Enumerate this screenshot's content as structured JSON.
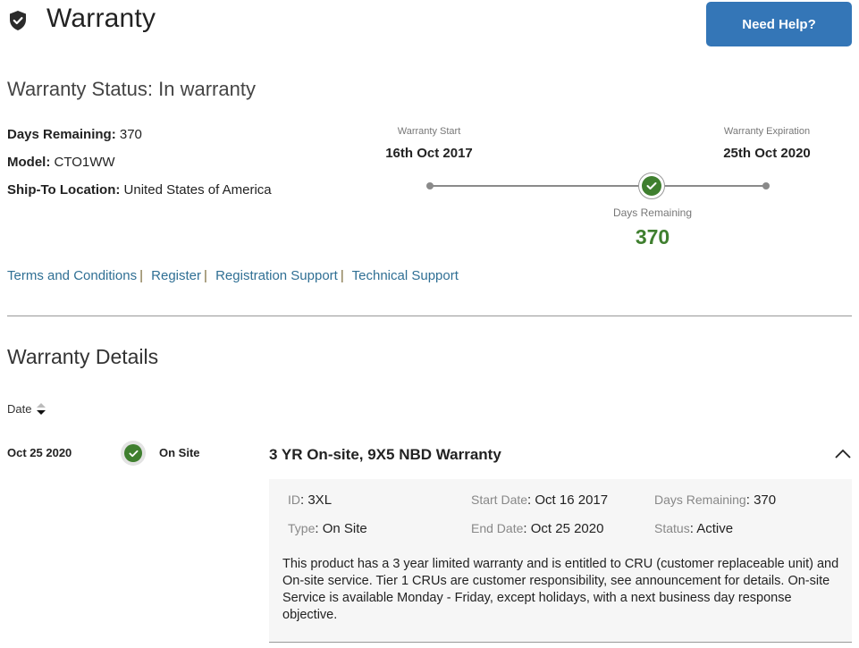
{
  "header": {
    "title": "Warranty",
    "icon": "shield-check-icon",
    "help_button": "Need Help?"
  },
  "status": {
    "title": "Warranty Status: In warranty",
    "days_remaining_label": "Days Remaining:",
    "days_remaining_value": "370",
    "model_label": "Model:",
    "model_value": "CTO1WW",
    "ship_label": "Ship-To Location:",
    "ship_value": "United States of America"
  },
  "timeline": {
    "start_label": "Warranty Start",
    "start_date": "16th Oct 2017",
    "end_label": "Warranty Expiration",
    "end_date": "25th Oct 2020",
    "remaining_label": "Days Remaining",
    "remaining_value": "370",
    "progress_fraction": 0.66,
    "accent_color": "#3f7f2f"
  },
  "links": [
    {
      "label": "Terms and Conditions"
    },
    {
      "label": "Register"
    },
    {
      "label": "Registration Support"
    },
    {
      "label": "Technical Support"
    }
  ],
  "link_separator": "|",
  "details": {
    "title": "Warranty Details",
    "sort_column": "Date",
    "rows": [
      {
        "date": "Oct 25 2020",
        "type": "On Site",
        "title": "3 YR On-site, 9X5 NBD Warranty",
        "expanded": true,
        "fields": {
          "id_label": "ID",
          "id_value": "3XL",
          "type_label": "Type",
          "type_value": "On Site",
          "start_label": "Start Date",
          "start_value": "Oct 16 2017",
          "end_label": "End Date",
          "end_value": "Oct 25 2020",
          "days_label": "Days Remaining",
          "days_value": "370",
          "status_label": "Status",
          "status_value": "Active"
        },
        "description": "This product has a 3 year limited warranty and is entitled to CRU (customer replaceable unit) and On-site service. Tier 1 CRUs are customer responsibility, see announcement for details. On-site Service is available Monday - Friday, except holidays, with a next business day response objective."
      }
    ]
  },
  "colors": {
    "primary_button": "#3476b7",
    "link": "#2f6f94",
    "success": "#3f7f2f"
  }
}
